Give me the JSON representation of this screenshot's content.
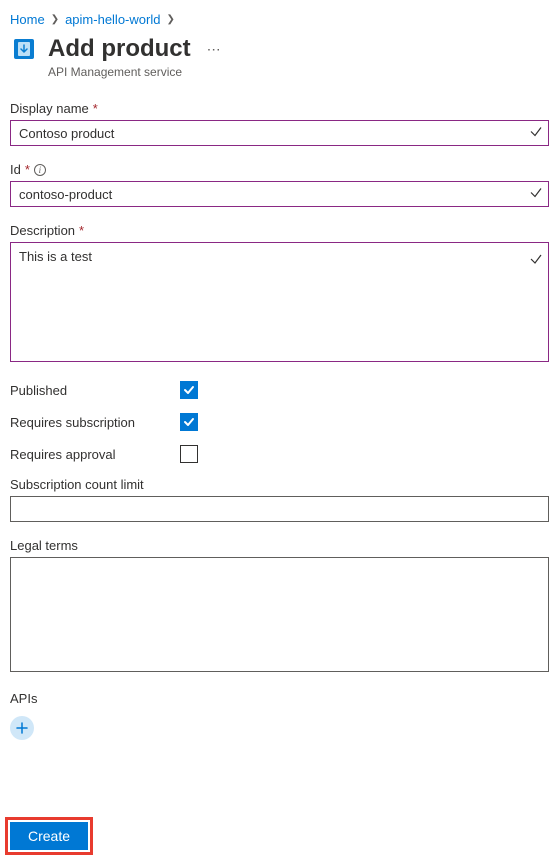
{
  "breadcrumb": {
    "home": "Home",
    "service": "apim-hello-world"
  },
  "header": {
    "title": "Add product",
    "subtitle": "API Management service"
  },
  "form": {
    "displayName": {
      "label": "Display name",
      "value": "Contoso product"
    },
    "id": {
      "label": "Id",
      "value": "contoso-product"
    },
    "description": {
      "label": "Description",
      "value": "This is a test"
    },
    "published": {
      "label": "Published",
      "checked": true
    },
    "requiresSubscription": {
      "label": "Requires subscription",
      "checked": true
    },
    "requiresApproval": {
      "label": "Requires approval",
      "checked": false
    },
    "subscriptionLimit": {
      "label": "Subscription count limit",
      "value": ""
    },
    "legalTerms": {
      "label": "Legal terms",
      "value": ""
    },
    "apis": {
      "label": "APIs"
    }
  },
  "actions": {
    "create": "Create"
  }
}
